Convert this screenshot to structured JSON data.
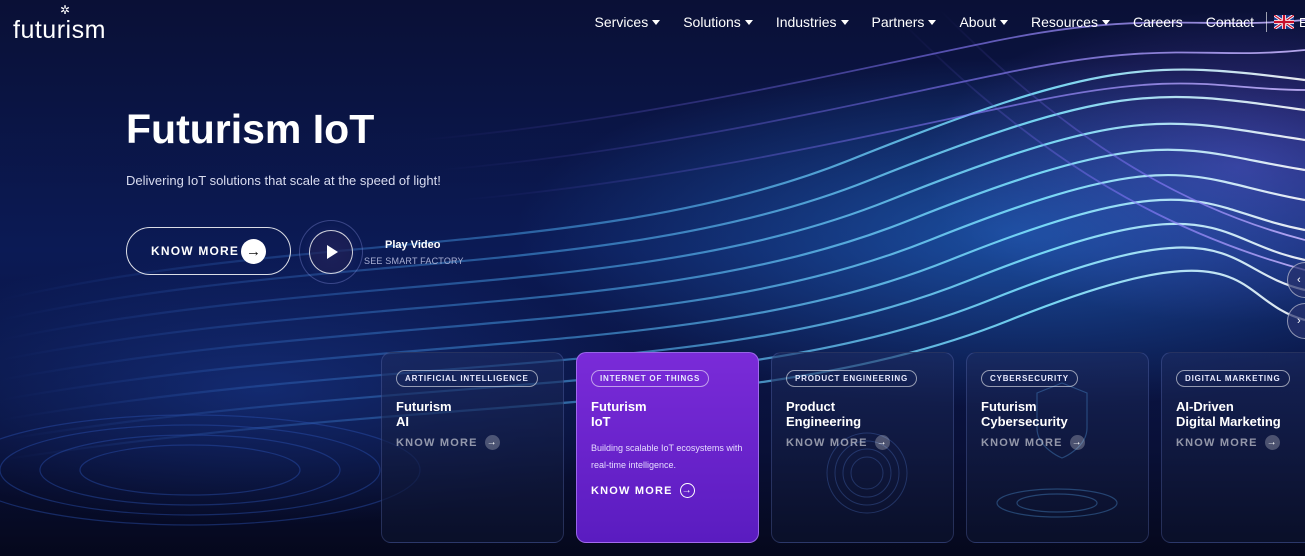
{
  "brand": {
    "name": "futurism",
    "star": "✲"
  },
  "nav": {
    "items": [
      {
        "label": "Services",
        "dropdown": true
      },
      {
        "label": "Solutions",
        "dropdown": true
      },
      {
        "label": "Industries",
        "dropdown": true
      },
      {
        "label": "Partners",
        "dropdown": true
      },
      {
        "label": "About",
        "dropdown": true
      },
      {
        "label": "Resources",
        "dropdown": true
      },
      {
        "label": "Careers",
        "dropdown": false
      },
      {
        "label": "Contact",
        "dropdown": false
      }
    ],
    "language": {
      "code": "EN",
      "flag_icon": "uk-flag-icon"
    }
  },
  "hero": {
    "title": "Futurism IoT",
    "subtitle": "Delivering IoT solutions that scale at the speed of light!",
    "cta_label": "KNOW MORE",
    "cta_arrow": "→",
    "video": {
      "title": "Play Video",
      "subtitle": "SEE SMART FACTORY"
    }
  },
  "slider_controls": {
    "prev": "‹",
    "next": "›"
  },
  "cards": [
    {
      "tag": "ARTIFICIAL INTELLIGENCE",
      "title_line1": "Futurism",
      "title_line2": "AI",
      "link": "KNOW MORE",
      "arrow": "→"
    },
    {
      "tag": "INTERNET OF THINGS",
      "title_line1": "Futurism",
      "title_line2": "IoT",
      "desc": "Building scalable IoT ecosystems with real-time intelligence.",
      "link": "KNOW MORE",
      "arrow": "→",
      "active": true
    },
    {
      "tag": "PRODUCT ENGINEERING",
      "title_line1": "Product",
      "title_line2": "Engineering",
      "link": "KNOW MORE",
      "arrow": "→"
    },
    {
      "tag": "CYBERSECURITY",
      "title_line1": "Futurism",
      "title_line2": "Cybersecurity",
      "link": "KNOW MORE",
      "arrow": "→"
    },
    {
      "tag": "DIGITAL MARKETING",
      "title_line1": "AI-Driven",
      "title_line2": "Digital Marketing",
      "link": "KNOW MORE",
      "arrow": "→"
    }
  ],
  "colors": {
    "background": "#070a24",
    "active_card": "#6a24cc",
    "accent_cyan": "#5fd6ff",
    "accent_violet": "#9b7bff"
  }
}
